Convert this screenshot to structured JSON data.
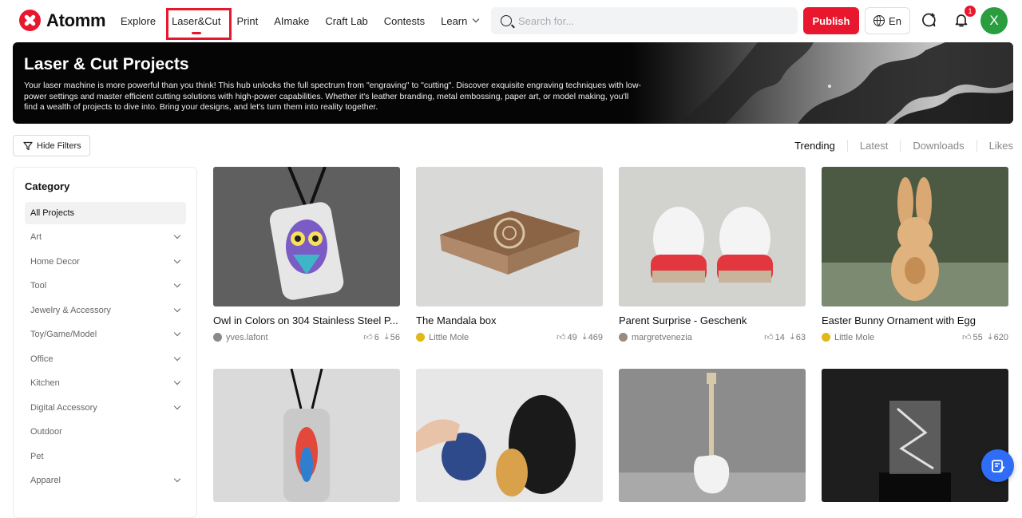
{
  "brand": {
    "name": "Atomm"
  },
  "nav": {
    "items": [
      {
        "label": "Explore"
      },
      {
        "label": "Laser&Cut"
      },
      {
        "label": "Print"
      },
      {
        "label": "AImake"
      },
      {
        "label": "Craft Lab"
      },
      {
        "label": "Contests"
      },
      {
        "label": "Learn"
      }
    ],
    "active": "Laser&Cut"
  },
  "search": {
    "placeholder": "Search for..."
  },
  "actions": {
    "publish": "Publish",
    "language": "En",
    "notification_count": "1",
    "avatar_letter": "X"
  },
  "banner": {
    "title": "Laser & Cut Projects",
    "description": "Your laser machine is more powerful than you think! This hub unlocks the full spectrum from \"engraving\" to \"cutting\". Discover exquisite engraving techniques with low-power settings and master efficient cutting solutions with high-power capabilities. Whether it's leather branding, metal embossing, paper art, or model making, you'll find a wealth of projects to dive into. Bring your designs, and let's turn them into reality together."
  },
  "filters": {
    "hide_label": "Hide Filters"
  },
  "sort": {
    "tabs": [
      "Trending",
      "Latest",
      "Downloads",
      "Likes"
    ],
    "active": "Trending"
  },
  "category": {
    "title": "Category",
    "items": [
      {
        "label": "All Projects",
        "expandable": false
      },
      {
        "label": "Art",
        "expandable": true
      },
      {
        "label": "Home Decor",
        "expandable": true
      },
      {
        "label": "Tool",
        "expandable": true
      },
      {
        "label": "Jewelry & Accessory",
        "expandable": true
      },
      {
        "label": "Toy/Game/Model",
        "expandable": true
      },
      {
        "label": "Office",
        "expandable": true
      },
      {
        "label": "Kitchen",
        "expandable": true
      },
      {
        "label": "Digital Accessory",
        "expandable": true
      },
      {
        "label": "Outdoor",
        "expandable": false
      },
      {
        "label": "Pet",
        "expandable": false
      },
      {
        "label": "Apparel",
        "expandable": true
      }
    ]
  },
  "projects": [
    {
      "title": "Owl in Colors on 304 Stainless Steel P...",
      "author": "yves.lafont",
      "likes": "6",
      "downloads": "56",
      "bg": "#5c5c5c",
      "author_color": "#8a8a8a"
    },
    {
      "title": "The Mandala box",
      "author": "Little Mole",
      "likes": "49",
      "downloads": "469",
      "bg": "#d6d6d4",
      "author_color": "#e0b81a"
    },
    {
      "title": "Parent Surprise - Geschenk",
      "author": "margretvenezia",
      "likes": "14",
      "downloads": "63",
      "bg": "#cfcfcc",
      "author_color": "#9c8a7a"
    },
    {
      "title": "Easter Bunny Ornament with Egg",
      "author": "Little Mole",
      "likes": "55",
      "downloads": "620",
      "bg": "#4e5a44",
      "author_color": "#e0b81a"
    },
    {
      "title": "",
      "author": "",
      "likes": "",
      "downloads": "",
      "bg": "#d8d8d8",
      "author_color": "#ccc"
    },
    {
      "title": "",
      "author": "",
      "likes": "",
      "downloads": "",
      "bg": "#e6e6e6",
      "author_color": "#ccc"
    },
    {
      "title": "",
      "author": "",
      "likes": "",
      "downloads": "",
      "bg": "#8a8a8a",
      "author_color": "#ccc"
    },
    {
      "title": "",
      "author": "",
      "likes": "",
      "downloads": "",
      "bg": "#222222",
      "author_color": "#ccc"
    }
  ]
}
